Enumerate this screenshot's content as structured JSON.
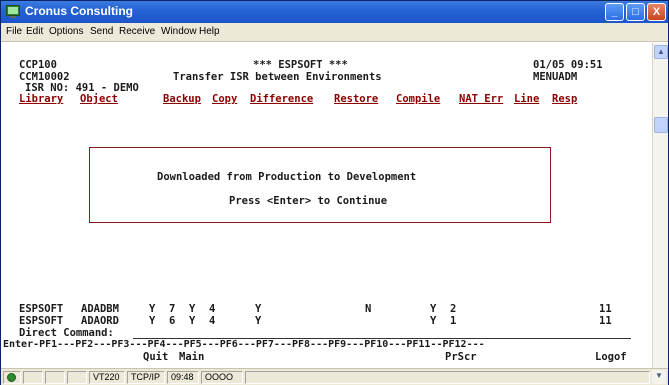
{
  "window": {
    "title": "Cronus Consulting",
    "controls": {
      "minimize": "_",
      "maximize": "□",
      "close": "X"
    }
  },
  "menu": [
    "File",
    "Edit",
    "Options",
    "Send",
    "Receive",
    "Window",
    "Help"
  ],
  "terminal": {
    "program_id": "CCP100",
    "banner": "*** ESPSOFT ***",
    "datetime": "01/05 09:51",
    "screen_id": "CCM10002",
    "screen_title": "Transfer ISR between Environments",
    "menu_id": "MENUADM",
    "isr_line": "ISR NO: 491 - DEMO",
    "actions": [
      "Library",
      "Object",
      "Backup",
      "Copy",
      "Difference",
      "Restore",
      "Compile",
      "NAT Err",
      "Line",
      "Resp"
    ],
    "dialog": {
      "message": "Downloaded from Production to Development",
      "prompt": "Press <Enter> to Continue"
    },
    "rows": [
      {
        "lib": "ESPSOFT",
        "obj": "ADADBM",
        "c1": "Y",
        "c2": "7",
        "c3": "Y",
        "c4": "4",
        "c5": "Y",
        "c6": "N",
        "c7": "Y",
        "c8": "2",
        "c9": "11"
      },
      {
        "lib": "ESPSOFT",
        "obj": "ADAORD",
        "c1": "Y",
        "c2": "6",
        "c3": "Y",
        "c4": "4",
        "c5": "Y",
        "c6": "",
        "c7": "Y",
        "c8": "1",
        "c9": "11"
      }
    ],
    "direct_command_label": "Direct Command:",
    "pf_line": "Enter-PF1---PF2---PF3---PF4---PF5---PF6---PF7---PF8---PF9---PF10---PF11--PF12---",
    "pf_labels": {
      "pf3": "Quit",
      "pf4": "Main",
      "pf9": "PrScr",
      "pf12": "Logof"
    }
  },
  "status": {
    "term_type": "VT220",
    "protocol": "TCP/IP",
    "time": "09:48",
    "indicators": "OOOO"
  },
  "colors": {
    "titlebar": "#2563d4",
    "link": "#8b0000",
    "chrome": "#ece9d8"
  }
}
